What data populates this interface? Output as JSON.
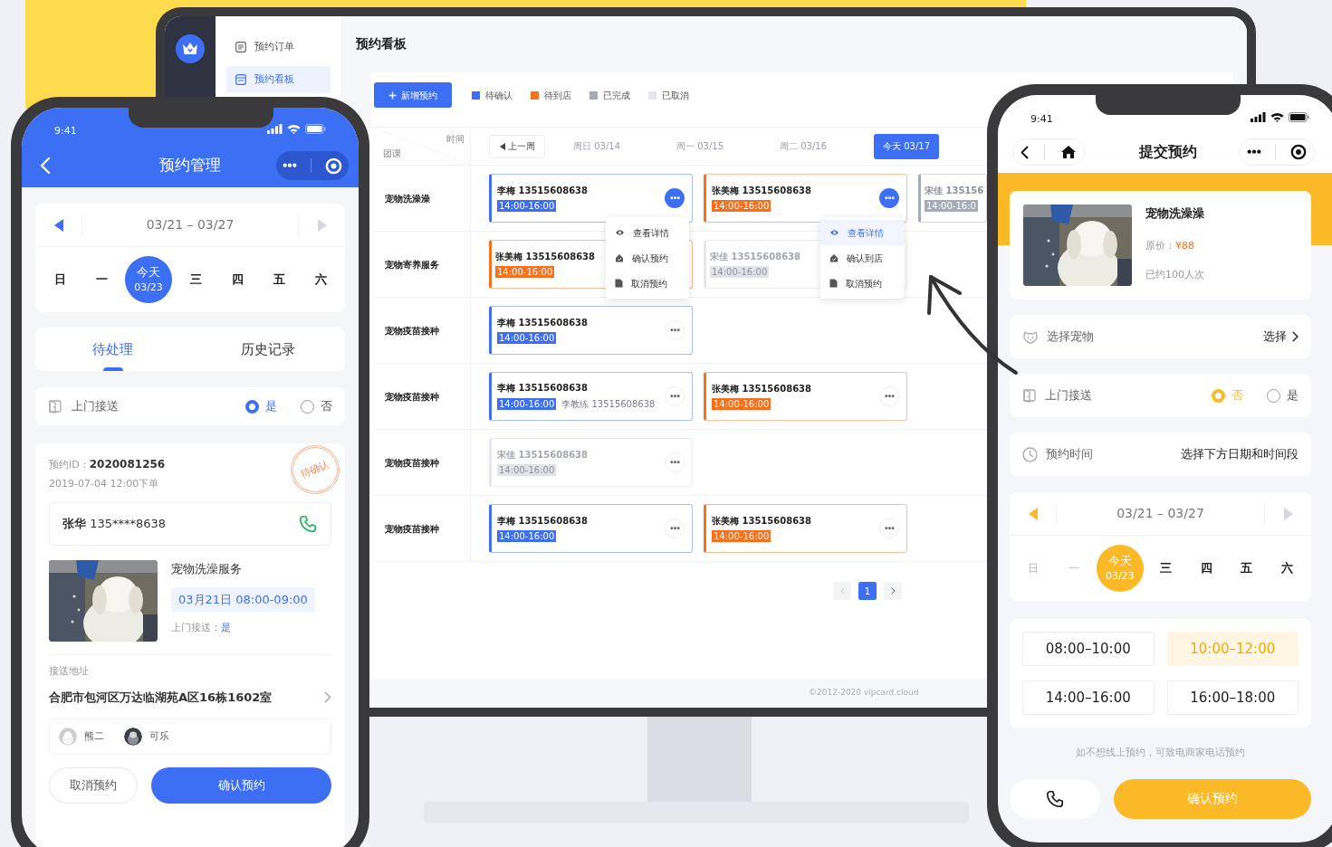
{
  "monitor": {
    "menu": [
      {
        "label": "预约订单",
        "selected": false
      },
      {
        "label": "预约看板",
        "selected": true
      }
    ],
    "title": "预约看板",
    "add_button": "新增预约",
    "legend": [
      {
        "label": "待确认",
        "color": "#3d6ff5"
      },
      {
        "label": "待到店",
        "color": "#f7701e"
      },
      {
        "label": "已完成",
        "color": "#a6abb8"
      },
      {
        "label": "已取消",
        "color": "#e4e6ec"
      }
    ],
    "corner": {
      "top": "时间",
      "bottom": "团课"
    },
    "prev_week": "上一周",
    "days": [
      {
        "label": "周日 03/14",
        "selected": false
      },
      {
        "label": "周一 03/15",
        "selected": false
      },
      {
        "label": "周二 03/16",
        "selected": false
      },
      {
        "label": "今天 03/17",
        "selected": true
      }
    ],
    "rows": [
      {
        "service": "宠物洗澡澡",
        "cards": [
          {
            "color": "#3d6ff5",
            "name": "李梅 13515608638",
            "time": "14:00-16:00",
            "active": true,
            "menu": [
              {
                "label": "查看详情",
                "selected": false
              },
              {
                "label": "确认预约",
                "selected": false
              },
              {
                "label": "取消预约",
                "selected": false
              }
            ]
          },
          {
            "color": "#f7701e",
            "name": "张美梅 13515608638",
            "time": "14:00-16:00",
            "active": true,
            "menu": [
              {
                "label": "查看详情",
                "selected": true
              },
              {
                "label": "确认到店",
                "selected": false
              },
              {
                "label": "取消预约",
                "selected": false
              }
            ]
          },
          {
            "color": "#a6abb8",
            "name": "宋佳 135156",
            "time": "14:00-16:0",
            "cut": true
          }
        ]
      },
      {
        "service": "宠物寄养服务",
        "cards": [
          {
            "color": "#f7701e",
            "name": "张美梅 13515608638",
            "time": "14:00-16:00",
            "cut": true
          },
          {
            "color": "#e4e6ec",
            "name": "宋佳 13515608638",
            "time": "14:00-16:00",
            "cut": true
          }
        ]
      },
      {
        "service": "宠物疫苗接种",
        "cards": [
          {
            "color": "#3d6ff5",
            "name": "李梅 13515608638",
            "time": "14:00-16:00",
            "active": false
          }
        ]
      },
      {
        "service": "宠物疫苗接种",
        "cards": [
          {
            "color": "#3d6ff5",
            "name": "李梅 13515608638",
            "time": "14:00-16:00",
            "extra": "李教练 13515608638",
            "active": false
          },
          {
            "color": "#f7701e",
            "name": "张美梅 13515608638",
            "time": "14:00-16:00",
            "active": false
          }
        ]
      },
      {
        "service": "宠物疫苗接种",
        "cards": [
          {
            "color": "#e4e6ec",
            "name": "宋佳 13515608638",
            "time": "14:00-16:00",
            "active": false
          }
        ]
      },
      {
        "service": "宠物疫苗接种",
        "cards": [
          {
            "color": "#3d6ff5",
            "name": "李梅 13515608638",
            "time": "14:00-16:00",
            "active": false
          },
          {
            "color": "#f7701e",
            "name": "张美梅 13515608638",
            "time": "14:00-16:00",
            "active": false
          }
        ]
      }
    ],
    "pages": [
      {
        "label": "1",
        "selected": true
      }
    ],
    "footer": "©2012-2020 vipcard.cloud"
  },
  "phone_left": {
    "time": "9:41",
    "title": "预约管理",
    "week": "03/21 – 03/27",
    "days": [
      {
        "label": "日",
        "selected": false
      },
      {
        "label": "一",
        "selected": false
      },
      {
        "label": "今天",
        "date": "03/23",
        "selected": true
      },
      {
        "label": "三",
        "selected": false
      },
      {
        "label": "四",
        "selected": false
      },
      {
        "label": "五",
        "selected": false
      },
      {
        "label": "六",
        "selected": false
      }
    ],
    "tabs": [
      {
        "label": "待处理",
        "selected": true
      },
      {
        "label": "历史记录",
        "selected": false
      }
    ],
    "pickup": {
      "label": "上门接送",
      "options": [
        {
          "label": "是",
          "selected": true
        },
        {
          "label": "否",
          "selected": false
        }
      ]
    },
    "order": {
      "id_label": "预约ID：",
      "id": "2020081256",
      "created": "2019-07-04 12:00下单",
      "stamp": "待确认",
      "customer": "**张华** 135****8638",
      "service": "宠物洗澡服务",
      "slot": "03月21日 08:00-09:00",
      "pickup_label": "上门接送：",
      "pickup_value": "是",
      "address_label": "接送地址",
      "address": "合肥市包河区万达临湖苑A区16栋1602室",
      "pets": [
        {
          "name": "熊二"
        },
        {
          "name": "可乐"
        }
      ]
    },
    "buttons": [
      {
        "label": "取消预约",
        "kind": "secondary"
      },
      {
        "label": "确认预约",
        "kind": "primary"
      }
    ]
  },
  "phone_right": {
    "time": "9:41",
    "title": "提交预约",
    "product": {
      "name": "宠物洗澡澡",
      "price_label": "原价：",
      "price": "¥88",
      "booked": "已约100人次"
    },
    "fields": [
      {
        "kind": "link",
        "label": "选择宠物",
        "value": "选择"
      },
      {
        "kind": "radio",
        "label": "上门接送",
        "options": [
          {
            "label": "否",
            "selected": true
          },
          {
            "label": "是",
            "selected": false
          }
        ]
      },
      {
        "kind": "text",
        "label": "预约时间",
        "value": "选择下方日期和时间段"
      }
    ],
    "week": "03/21 – 03/27",
    "days": [
      {
        "label": "日",
        "selected": false,
        "disabled": true
      },
      {
        "label": "一",
        "selected": false,
        "disabled": true
      },
      {
        "label": "今天",
        "date": "03/23",
        "selected": true,
        "disabled": false
      },
      {
        "label": "三",
        "selected": false,
        "disabled": false
      },
      {
        "label": "四",
        "selected": false,
        "disabled": false
      },
      {
        "label": "五",
        "selected": false,
        "disabled": false
      },
      {
        "label": "六",
        "selected": false,
        "disabled": false
      }
    ],
    "slots": [
      {
        "label": "08:00–10:00",
        "selected": false
      },
      {
        "label": "10:00–12:00",
        "selected": true
      },
      {
        "label": "14:00–16:00",
        "selected": false
      },
      {
        "label": "16:00–18:00",
        "selected": false
      }
    ],
    "note": "如不想线上预约，可致电商家电话预约",
    "confirm": "确认预约"
  }
}
